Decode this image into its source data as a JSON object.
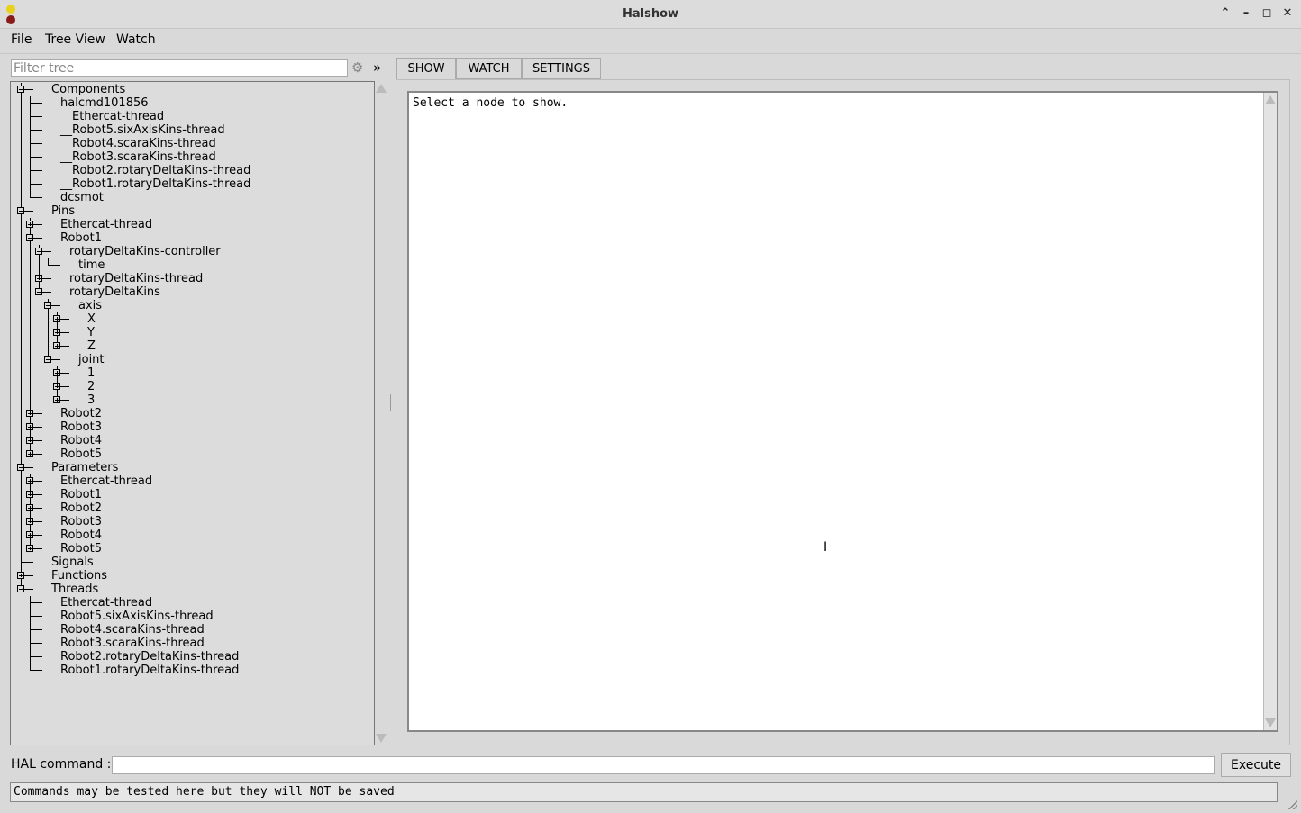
{
  "window": {
    "title": "Halshow"
  },
  "menu": [
    "File",
    "Tree View",
    "Watch"
  ],
  "filter": {
    "placeholder": "Filter tree",
    "gear_icon": "gear-icon",
    "expand_symbol": "»"
  },
  "tree": [
    {
      "label": "Components",
      "level": 0,
      "expander": "minus"
    },
    {
      "label": "halcmd101856",
      "level": 1,
      "expander": null
    },
    {
      "label": "__Ethercat-thread",
      "level": 1,
      "expander": null
    },
    {
      "label": "__Robot5.sixAxisKins-thread",
      "level": 1,
      "expander": null
    },
    {
      "label": "__Robot4.scaraKins-thread",
      "level": 1,
      "expander": null
    },
    {
      "label": "__Robot3.scaraKins-thread",
      "level": 1,
      "expander": null
    },
    {
      "label": "__Robot2.rotaryDeltaKins-thread",
      "level": 1,
      "expander": null
    },
    {
      "label": "__Robot1.rotaryDeltaKins-thread",
      "level": 1,
      "expander": null
    },
    {
      "label": "dcsmot",
      "level": 1,
      "expander": null
    },
    {
      "label": "Pins",
      "level": 0,
      "expander": "minus"
    },
    {
      "label": "Ethercat-thread",
      "level": 1,
      "expander": "plus"
    },
    {
      "label": "Robot1",
      "level": 1,
      "expander": "minus"
    },
    {
      "label": "rotaryDeltaKins-controller",
      "level": 2,
      "expander": "minus"
    },
    {
      "label": "time",
      "level": 3,
      "expander": null
    },
    {
      "label": "rotaryDeltaKins-thread",
      "level": 2,
      "expander": "plus"
    },
    {
      "label": "rotaryDeltaKins",
      "level": 2,
      "expander": "minus"
    },
    {
      "label": "axis",
      "level": 3,
      "expander": "minus"
    },
    {
      "label": "X",
      "level": 4,
      "expander": "plus"
    },
    {
      "label": "Y",
      "level": 4,
      "expander": "plus"
    },
    {
      "label": "Z",
      "level": 4,
      "expander": "plus"
    },
    {
      "label": "joint",
      "level": 3,
      "expander": "minus"
    },
    {
      "label": "1",
      "level": 4,
      "expander": "plus"
    },
    {
      "label": "2",
      "level": 4,
      "expander": "plus"
    },
    {
      "label": "3",
      "level": 4,
      "expander": "plus"
    },
    {
      "label": "Robot2",
      "level": 1,
      "expander": "plus"
    },
    {
      "label": "Robot3",
      "level": 1,
      "expander": "plus"
    },
    {
      "label": "Robot4",
      "level": 1,
      "expander": "plus"
    },
    {
      "label": "Robot5",
      "level": 1,
      "expander": "plus"
    },
    {
      "label": "Parameters",
      "level": 0,
      "expander": "minus"
    },
    {
      "label": "Ethercat-thread",
      "level": 1,
      "expander": "plus"
    },
    {
      "label": "Robot1",
      "level": 1,
      "expander": "plus"
    },
    {
      "label": "Robot2",
      "level": 1,
      "expander": "plus"
    },
    {
      "label": "Robot3",
      "level": 1,
      "expander": "plus"
    },
    {
      "label": "Robot4",
      "level": 1,
      "expander": "plus"
    },
    {
      "label": "Robot5",
      "level": 1,
      "expander": "plus"
    },
    {
      "label": "Signals",
      "level": 0,
      "expander": null
    },
    {
      "label": "Functions",
      "level": 0,
      "expander": "plus"
    },
    {
      "label": "Threads",
      "level": 0,
      "expander": "minus"
    },
    {
      "label": "Ethercat-thread",
      "level": 1,
      "expander": null
    },
    {
      "label": "Robot5.sixAxisKins-thread",
      "level": 1,
      "expander": null
    },
    {
      "label": "Robot4.scaraKins-thread",
      "level": 1,
      "expander": null
    },
    {
      "label": "Robot3.scaraKins-thread",
      "level": 1,
      "expander": null
    },
    {
      "label": "Robot2.rotaryDeltaKins-thread",
      "level": 1,
      "expander": null
    },
    {
      "label": "Robot1.rotaryDeltaKins-thread",
      "level": 1,
      "expander": null
    }
  ],
  "tabs": [
    {
      "label": "SHOW",
      "active": true
    },
    {
      "label": "WATCH",
      "active": false
    },
    {
      "label": "SETTINGS",
      "active": false
    }
  ],
  "show_text": "Select a node to show.",
  "hal": {
    "label": "HAL command :",
    "value": "",
    "execute_label": "Execute"
  },
  "status": "Commands may be tested here but they will NOT be saved"
}
